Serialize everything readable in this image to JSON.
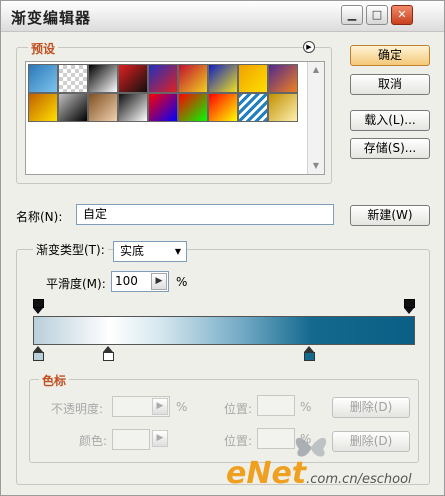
{
  "window": {
    "title": "渐变编辑器",
    "controls": [
      "minimize-icon",
      "restore-icon",
      "close-icon"
    ]
  },
  "presets": {
    "label": "预设",
    "menu_icon": "circle-arrow-right-icon",
    "swatches": [
      [
        "#2a78b8",
        "#7ec4ee"
      ],
      [
        "#ffffff",
        "#ffffff"
      ],
      [
        "#000000",
        "#ffffff"
      ],
      [
        "#e02020",
        "#101010"
      ],
      [
        "#2030c0",
        "#e02020"
      ],
      [
        "#c01030",
        "#f0d020"
      ],
      [
        "#1020c0",
        "#f0e020"
      ],
      [
        "#f0a000",
        "#ffe000"
      ],
      [
        "#502890",
        "#f08020"
      ],
      [
        "#c06000",
        "#ffe000"
      ],
      [
        "#c0c0c0",
        "#000000"
      ],
      [
        "#805020",
        "#f0d0b0"
      ],
      [
        "#101010",
        "#ffffff"
      ],
      [
        "#ff0000",
        "#0000ff"
      ],
      [
        "#ff0000",
        "#00ff00"
      ],
      [
        "#ff0000",
        "#ffff00"
      ],
      [
        "#2080c0",
        "#ffffff"
      ],
      [
        "#c09000",
        "#fff0b0"
      ]
    ]
  },
  "buttons": {
    "ok": "确定",
    "cancel": "取消",
    "load": "载入(L)...",
    "save": "存储(S)...",
    "new": "新建(W)",
    "delete_opacity": "删除(D)",
    "delete_color": "删除(D)"
  },
  "name": {
    "label": "名称(N):",
    "value": "自定"
  },
  "gradient": {
    "type_label": "渐变类型(T):",
    "type_value": "实底",
    "smooth_label": "平滑度(M):",
    "smooth_value": "100",
    "smooth_unit": "%",
    "opacity_stops": [
      0.0,
      1.0
    ],
    "color_stops": [
      {
        "pos": 0.0,
        "color": "#b9cfda"
      },
      {
        "pos": 0.19,
        "color": "#ffffff"
      },
      {
        "pos": 0.73,
        "color": "#14698e"
      }
    ],
    "bar_colors": [
      "#b9cfda",
      "#ffffff",
      "#d7e8ef",
      "#71a9c4",
      "#14698e",
      "#0a5f86"
    ]
  },
  "stops_section": {
    "label": "色标",
    "opacity_label": "不透明度:",
    "opacity_unit": "%",
    "position_label": "位置:",
    "position_unit": "%",
    "color_label": "颜色:",
    "position2_label": "位置:",
    "position2_unit": "%"
  },
  "watermark": {
    "brand": "eNet",
    "domain": ".com.cn/eschool"
  }
}
